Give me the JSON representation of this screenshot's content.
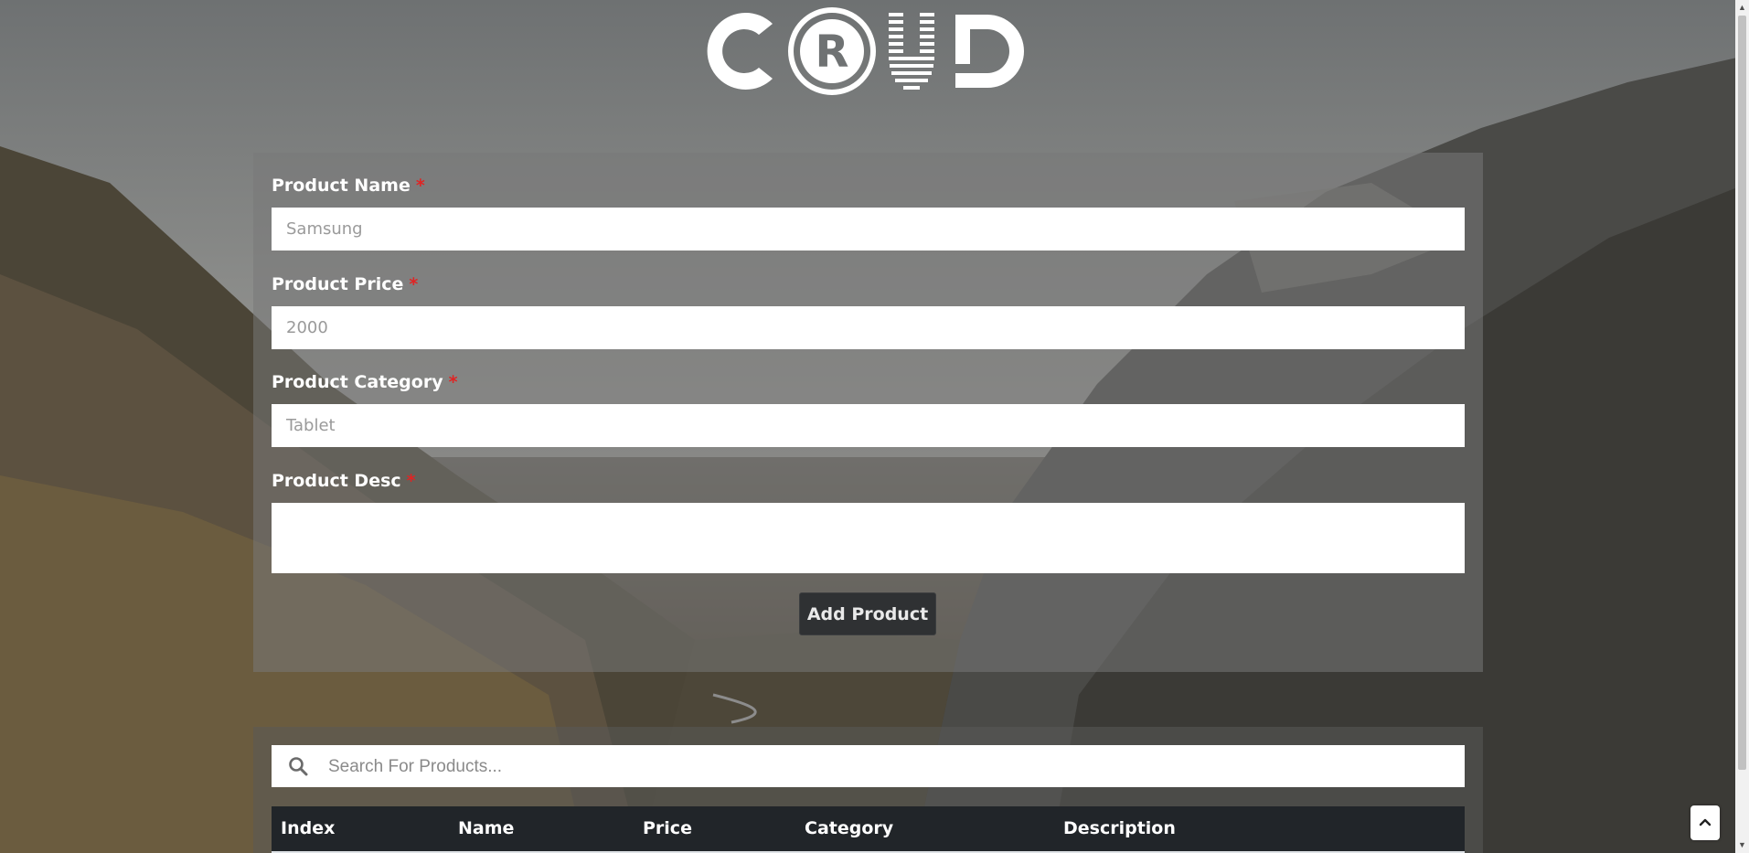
{
  "logo": {
    "letters": [
      "C",
      "R",
      "U",
      "D"
    ]
  },
  "form": {
    "fields": [
      {
        "label": "Product Name",
        "required_mark": "*",
        "placeholder": "Samsung",
        "value": ""
      },
      {
        "label": "Product Price",
        "required_mark": "*",
        "placeholder": "2000",
        "value": ""
      },
      {
        "label": "Product Category",
        "required_mark": "*",
        "placeholder": "Tablet",
        "value": ""
      },
      {
        "label": "Product Desc",
        "required_mark": "*",
        "placeholder": "",
        "value": ""
      }
    ],
    "submit_label": "Add Product"
  },
  "search": {
    "placeholder": "Search For Products...",
    "value": "",
    "icon": "search-icon"
  },
  "table": {
    "headers": [
      "Index",
      "Name",
      "Price",
      "Category",
      "Description"
    ]
  },
  "scroll_top_button": {
    "icon": "chevron-up-icon"
  },
  "colors": {
    "required": "#e02424",
    "button_bg": "#2f3133",
    "table_header_bg": "#212529"
  }
}
